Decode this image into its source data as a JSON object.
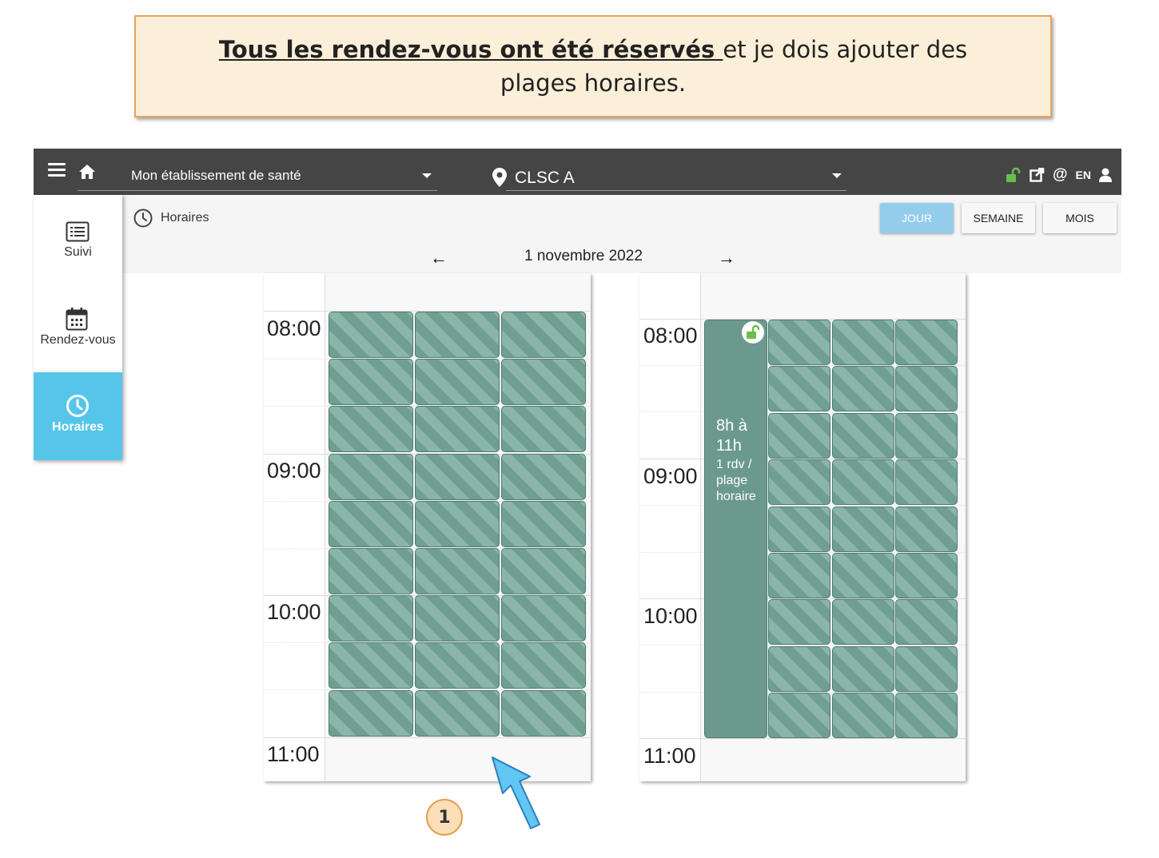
{
  "callout": {
    "bold_text": "Tous les rendez-vous ont été réservés ",
    "rest_text": "et je dois ajouter des plages horaires."
  },
  "topbar": {
    "establishment": "Mon établissement de santé",
    "location": "CLSC A",
    "language": "EN",
    "icons": [
      "menu-icon",
      "home-icon",
      "map-pin-icon",
      "unlock-icon",
      "external-link-icon",
      "at-icon",
      "user-icon"
    ]
  },
  "sidebar": {
    "items": [
      {
        "label": "Suivi",
        "icon": "list-icon",
        "active": false
      },
      {
        "label": "Rendez-vous",
        "icon": "calendar-icon",
        "active": false
      },
      {
        "label": "Horaires",
        "icon": "clock-icon",
        "active": true
      }
    ]
  },
  "subheader": {
    "title": "Horaires",
    "views": [
      "JOUR",
      "SEMAINE",
      "MOIS"
    ],
    "active_view": "JOUR",
    "date": "1 novembre 2022",
    "prev": "←",
    "next": "→"
  },
  "calendar_left": {
    "times": [
      "08:00",
      "09:00",
      "10:00",
      "11:00"
    ]
  },
  "calendar_right": {
    "times": [
      "08:00",
      "09:00",
      "10:00",
      "11:00"
    ],
    "block": {
      "hours": "8h à 11h",
      "detail": "1 rdv / plage horaire"
    }
  },
  "step_badge": "1",
  "colors": {
    "topbar": "#454545",
    "accent": "#55c6ea",
    "slot": "#6f9f93",
    "callout_bg": "#fcefd9",
    "callout_border": "#e9a35a",
    "lock_green": "#6abf4b"
  }
}
